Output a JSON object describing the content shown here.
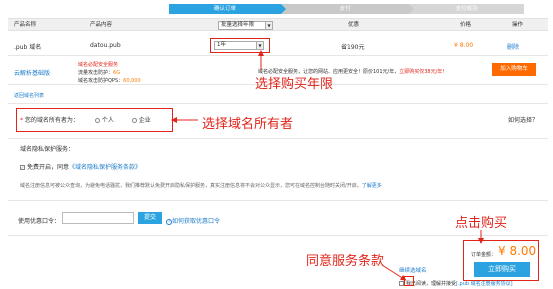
{
  "steps": [
    "确认订单",
    "支付",
    "支付成功"
  ],
  "table": {
    "headers": {
      "product_name": "产品名称",
      "product_content": "产品内容",
      "bulk_select": "批量选择年限",
      "discount": "优惠",
      "price": "价格",
      "action": "操作"
    },
    "row": {
      "name": ".pub 域名",
      "domain": "datou.pub",
      "years": "1年",
      "discount": "省190元",
      "price": "¥ 8.00",
      "delete": "删除"
    }
  },
  "promo": {
    "cloud_dns": "云解析基础版",
    "security_title": "域名必配安全服务",
    "defense_label": "流量攻击防护：",
    "defense_value": "6G",
    "qps_label": "域名攻击防护QPS：",
    "qps_value": "60,000",
    "desc_prefix": "域名必配安全服务，让您的网站、应用更安全！原价101元/年，",
    "desc_link": "立即购买仅38元/年！",
    "join_button": "加入购物车"
  },
  "links": {
    "domain_list": "返回域名列表",
    "how_to_choose": "如何选择？",
    "privacy_terms": "《域名隐私保护服务条款》",
    "learn_more": "了解更多",
    "get_coupon": "如何获取优惠口令"
  },
  "owner": {
    "label": "您的域名所有者为：",
    "opt_personal": "个人",
    "opt_company": "企业"
  },
  "privacy": {
    "title": "域名隐私保护服务：",
    "checkbox_text": "免费开启，同意",
    "desc": "域名注册信息可被公众查询，为避免电话骚扰，我们推荐默认免费开启隐私保护服务，真实注册信息将不会对公众显示，您可在域名控制台随时关闭/开启。"
  },
  "coupon": {
    "label": "使用优惠口令：",
    "input_value": "",
    "button": "提交"
  },
  "checkout": {
    "total_label": "订单金额：",
    "total_value": "¥ 8.00",
    "buy_button": "立即购买",
    "continue_label": "继续选域名",
    "agree_text": "我已阅读，理解并接受",
    "agree_link": "[.pub 域名注册服务协议]"
  },
  "annotations": {
    "choose_years": "选择购买年限",
    "choose_owner": "选择域名所有者",
    "agree_terms": "同意服务条款",
    "click_buy": "点击购买"
  },
  "colors": {
    "accent_blue": "#2aa3e0",
    "annotation_red": "#e1251b",
    "price_orange": "#ff7a00"
  }
}
